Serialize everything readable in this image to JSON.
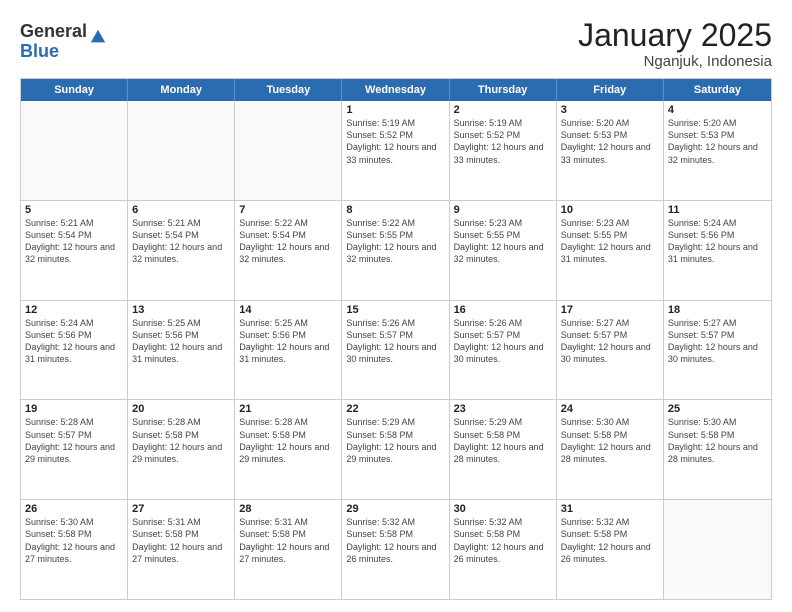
{
  "logo": {
    "general": "General",
    "blue": "Blue"
  },
  "header": {
    "month": "January 2025",
    "location": "Nganjuk, Indonesia"
  },
  "weekdays": [
    "Sunday",
    "Monday",
    "Tuesday",
    "Wednesday",
    "Thursday",
    "Friday",
    "Saturday"
  ],
  "rows": [
    [
      {
        "day": "",
        "empty": true
      },
      {
        "day": "",
        "empty": true
      },
      {
        "day": "",
        "empty": true
      },
      {
        "day": "1",
        "sunrise": "5:19 AM",
        "sunset": "5:52 PM",
        "daylight": "12 hours and 33 minutes."
      },
      {
        "day": "2",
        "sunrise": "5:19 AM",
        "sunset": "5:52 PM",
        "daylight": "12 hours and 33 minutes."
      },
      {
        "day": "3",
        "sunrise": "5:20 AM",
        "sunset": "5:53 PM",
        "daylight": "12 hours and 33 minutes."
      },
      {
        "day": "4",
        "sunrise": "5:20 AM",
        "sunset": "5:53 PM",
        "daylight": "12 hours and 32 minutes."
      }
    ],
    [
      {
        "day": "5",
        "sunrise": "5:21 AM",
        "sunset": "5:54 PM",
        "daylight": "12 hours and 32 minutes."
      },
      {
        "day": "6",
        "sunrise": "5:21 AM",
        "sunset": "5:54 PM",
        "daylight": "12 hours and 32 minutes."
      },
      {
        "day": "7",
        "sunrise": "5:22 AM",
        "sunset": "5:54 PM",
        "daylight": "12 hours and 32 minutes."
      },
      {
        "day": "8",
        "sunrise": "5:22 AM",
        "sunset": "5:55 PM",
        "daylight": "12 hours and 32 minutes."
      },
      {
        "day": "9",
        "sunrise": "5:23 AM",
        "sunset": "5:55 PM",
        "daylight": "12 hours and 32 minutes."
      },
      {
        "day": "10",
        "sunrise": "5:23 AM",
        "sunset": "5:55 PM",
        "daylight": "12 hours and 31 minutes."
      },
      {
        "day": "11",
        "sunrise": "5:24 AM",
        "sunset": "5:56 PM",
        "daylight": "12 hours and 31 minutes."
      }
    ],
    [
      {
        "day": "12",
        "sunrise": "5:24 AM",
        "sunset": "5:56 PM",
        "daylight": "12 hours and 31 minutes."
      },
      {
        "day": "13",
        "sunrise": "5:25 AM",
        "sunset": "5:56 PM",
        "daylight": "12 hours and 31 minutes."
      },
      {
        "day": "14",
        "sunrise": "5:25 AM",
        "sunset": "5:56 PM",
        "daylight": "12 hours and 31 minutes."
      },
      {
        "day": "15",
        "sunrise": "5:26 AM",
        "sunset": "5:57 PM",
        "daylight": "12 hours and 30 minutes."
      },
      {
        "day": "16",
        "sunrise": "5:26 AM",
        "sunset": "5:57 PM",
        "daylight": "12 hours and 30 minutes."
      },
      {
        "day": "17",
        "sunrise": "5:27 AM",
        "sunset": "5:57 PM",
        "daylight": "12 hours and 30 minutes."
      },
      {
        "day": "18",
        "sunrise": "5:27 AM",
        "sunset": "5:57 PM",
        "daylight": "12 hours and 30 minutes."
      }
    ],
    [
      {
        "day": "19",
        "sunrise": "5:28 AM",
        "sunset": "5:57 PM",
        "daylight": "12 hours and 29 minutes."
      },
      {
        "day": "20",
        "sunrise": "5:28 AM",
        "sunset": "5:58 PM",
        "daylight": "12 hours and 29 minutes."
      },
      {
        "day": "21",
        "sunrise": "5:28 AM",
        "sunset": "5:58 PM",
        "daylight": "12 hours and 29 minutes."
      },
      {
        "day": "22",
        "sunrise": "5:29 AM",
        "sunset": "5:58 PM",
        "daylight": "12 hours and 29 minutes."
      },
      {
        "day": "23",
        "sunrise": "5:29 AM",
        "sunset": "5:58 PM",
        "daylight": "12 hours and 28 minutes."
      },
      {
        "day": "24",
        "sunrise": "5:30 AM",
        "sunset": "5:58 PM",
        "daylight": "12 hours and 28 minutes."
      },
      {
        "day": "25",
        "sunrise": "5:30 AM",
        "sunset": "5:58 PM",
        "daylight": "12 hours and 28 minutes."
      }
    ],
    [
      {
        "day": "26",
        "sunrise": "5:30 AM",
        "sunset": "5:58 PM",
        "daylight": "12 hours and 27 minutes."
      },
      {
        "day": "27",
        "sunrise": "5:31 AM",
        "sunset": "5:58 PM",
        "daylight": "12 hours and 27 minutes."
      },
      {
        "day": "28",
        "sunrise": "5:31 AM",
        "sunset": "5:58 PM",
        "daylight": "12 hours and 27 minutes."
      },
      {
        "day": "29",
        "sunrise": "5:32 AM",
        "sunset": "5:58 PM",
        "daylight": "12 hours and 26 minutes."
      },
      {
        "day": "30",
        "sunrise": "5:32 AM",
        "sunset": "5:58 PM",
        "daylight": "12 hours and 26 minutes."
      },
      {
        "day": "31",
        "sunrise": "5:32 AM",
        "sunset": "5:58 PM",
        "daylight": "12 hours and 26 minutes."
      },
      {
        "day": "",
        "empty": true
      }
    ]
  ]
}
